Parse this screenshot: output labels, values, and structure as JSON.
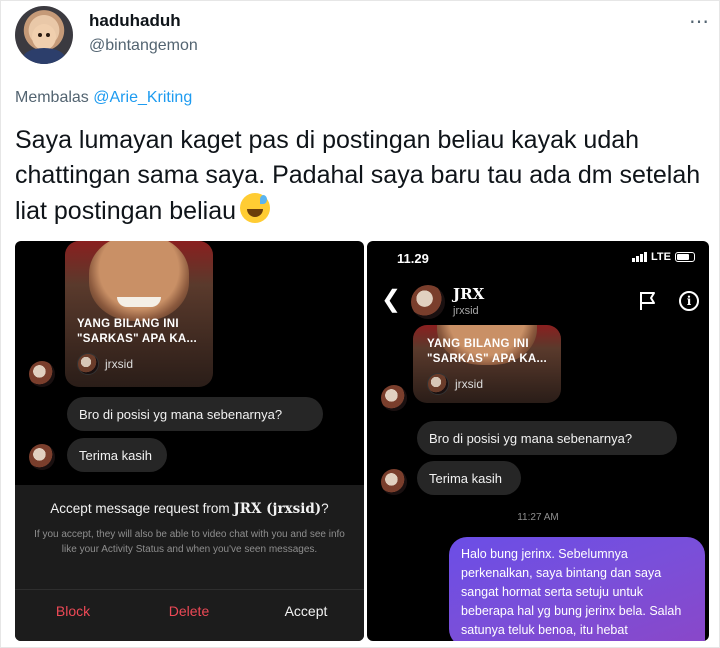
{
  "tweet": {
    "display_name": "haduhaduh",
    "handle": "@bintangemon",
    "reply_prefix": "Membalas",
    "reply_mention": "@Arie_Kriting",
    "text": "Saya lumayan kaget pas di postingan beliau kayak udah chattingan sama saya. Padahal saya baru tau ada dm setelah liat postingan beliau",
    "more_icon": "more-icon",
    "emoji": "sweat-smile-emoji"
  },
  "left_screenshot": {
    "story_caption_line1": "YANG BILANG INI",
    "story_caption_line2": "\"SARKAS\" APA KA...",
    "story_owner": "jrxsid",
    "messages": [
      "Bro di posisi yg mana sebenarnya?",
      "Terima kasih"
    ],
    "request": {
      "title_prefix": "Accept message request from ",
      "title_name": "JRX (jrxsid)",
      "title_suffix": "?",
      "description": "If you accept, they will also be able to video chat with you and see info like your Activity Status and when you've seen messages.",
      "block_label": "Block",
      "delete_label": "Delete",
      "accept_label": "Accept"
    }
  },
  "right_screenshot": {
    "status_time": "11.29",
    "network": "LTE",
    "header_name": "JRX",
    "header_username": "jrxsid",
    "story_caption_line1": "YANG BILANG INI",
    "story_caption_line2": "\"SARKAS\" APA KA...",
    "story_owner": "jrxsid",
    "messages": [
      "Bro di posisi yg mana sebenarnya?",
      "Terima kasih"
    ],
    "timestamp": "11:27 AM",
    "outgoing_message": "Halo bung jerinx. Sebelumnya perkenalkan, saya bintang dan saya sangat hormat serta setuju untuk beberapa hal yg bung jerinx bela. Salah satunya teluk benoa, itu hebat"
  },
  "colors": {
    "mention": "#1d9bf0",
    "danger": "#ed4956",
    "bubble_incoming": "#262626",
    "bubble_outgoing": "#7a4fd9"
  }
}
